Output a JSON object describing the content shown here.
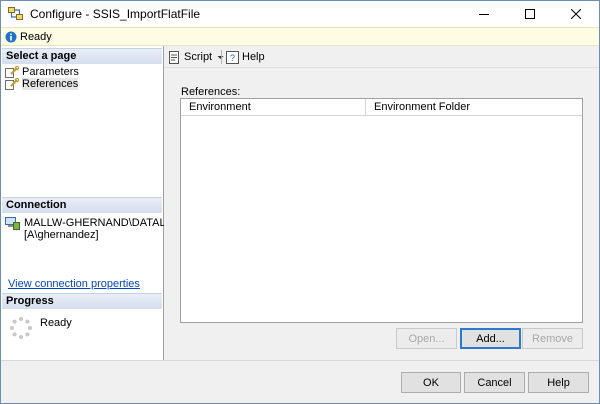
{
  "window": {
    "title": "Configure - SSIS_ImportFlatFile",
    "icon": "ssis-package-icon",
    "controls": [
      "minimize-icon",
      "maximize-icon",
      "close-icon"
    ]
  },
  "status": {
    "text": "Ready",
    "icon": "status-ready-icon"
  },
  "left_panel": {
    "select_page_header": "Select a page",
    "pages": [
      {
        "label": "Parameters",
        "icon": "wrench-page-icon",
        "selected": false
      },
      {
        "label": "References",
        "icon": "wrench-page-icon",
        "selected": true
      }
    ],
    "connection_header": "Connection",
    "connection": {
      "server": "MALLW-GHERNAND\\DATALAB",
      "user": "[A\\ghernandez]",
      "icon": "server-connection-icon"
    },
    "view_connection_link": "View connection properties",
    "progress_header": "Progress",
    "progress_text": "Ready"
  },
  "toolbar": {
    "script_label": "Script",
    "help_label": "Help"
  },
  "references": {
    "label": "References:",
    "columns": [
      "Environment",
      "Environment Folder"
    ],
    "rows": [],
    "buttons": {
      "open": "Open...",
      "add": "Add...",
      "remove": "Remove"
    }
  },
  "footer": {
    "ok": "OK",
    "cancel": "Cancel",
    "help": "Help"
  },
  "colors": {
    "status_bg": "#fefde4",
    "link": "#0645c2",
    "section_header": "#d5dfee",
    "default_button_border": "#2f78cf"
  }
}
